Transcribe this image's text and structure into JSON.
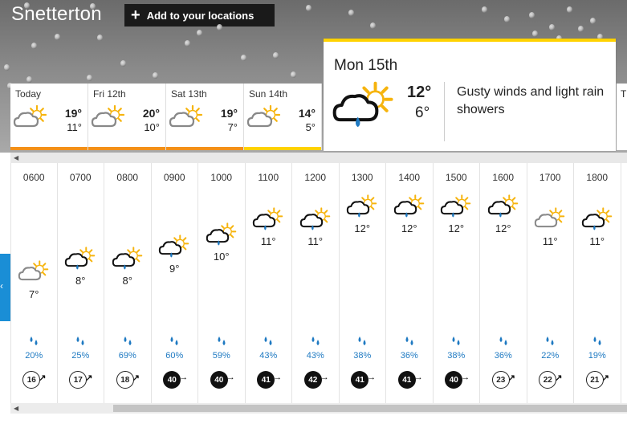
{
  "location": {
    "title": "Snetterton"
  },
  "add_button": {
    "label": "Add to your locations",
    "plus": "+"
  },
  "colors": {
    "today_bar": "#f39018",
    "sun_bar": "#ffd200",
    "accent_blue": "#1a8ed6",
    "rain_blue": "#1f7ac2"
  },
  "days": [
    {
      "label": "Today",
      "hi": "19°",
      "lo": "11°",
      "icon": "sun-cloud-icon",
      "bar": "#f39018"
    },
    {
      "label": "Fri 12th",
      "hi": "20°",
      "lo": "10°",
      "icon": "sun-cloud-icon",
      "bar": "#f39018"
    },
    {
      "label": "Sat 13th",
      "hi": "19°",
      "lo": "7°",
      "icon": "sun-cloud-icon",
      "bar": "#f39018"
    },
    {
      "label": "Sun 14th",
      "hi": "14°",
      "lo": "5°",
      "icon": "sun-cloud-icon",
      "bar": "#ffd200"
    }
  ],
  "selected_day": {
    "day": "Mon",
    "date": "15th",
    "hi": "12°",
    "lo": "6°",
    "description": "Gusty winds and light rain showers",
    "icon": "sun-rain-cloud-icon"
  },
  "next_day_stub": {
    "label": "T"
  },
  "hours": [
    {
      "time": "0600",
      "temp": "7°",
      "icon": "sun-cloud-icon",
      "rain": "20%",
      "wind": "16",
      "wind_style": "light"
    },
    {
      "time": "0700",
      "temp": "8°",
      "icon": "sun-rain-cloud-icon",
      "rain": "25%",
      "wind": "17",
      "wind_style": "light"
    },
    {
      "time": "0800",
      "temp": "8°",
      "icon": "sun-rain-cloud-icon",
      "rain": "69%",
      "wind": "18",
      "wind_style": "light"
    },
    {
      "time": "0900",
      "temp": "9°",
      "icon": "sun-rain-cloud-icon",
      "rain": "60%",
      "wind": "40",
      "wind_style": "dark"
    },
    {
      "time": "1000",
      "temp": "10°",
      "icon": "sun-rain-cloud-icon",
      "rain": "59%",
      "wind": "40",
      "wind_style": "dark"
    },
    {
      "time": "1100",
      "temp": "11°",
      "icon": "sun-rain-cloud-icon",
      "rain": "43%",
      "wind": "41",
      "wind_style": "dark"
    },
    {
      "time": "1200",
      "temp": "11°",
      "icon": "sun-rain-cloud-icon",
      "rain": "43%",
      "wind": "42",
      "wind_style": "dark"
    },
    {
      "time": "1300",
      "temp": "12°",
      "icon": "sun-rain-cloud-icon",
      "rain": "38%",
      "wind": "41",
      "wind_style": "dark"
    },
    {
      "time": "1400",
      "temp": "12°",
      "icon": "sun-rain-cloud-icon",
      "rain": "36%",
      "wind": "41",
      "wind_style": "dark"
    },
    {
      "time": "1500",
      "temp": "12°",
      "icon": "sun-rain-cloud-icon",
      "rain": "38%",
      "wind": "40",
      "wind_style": "dark"
    },
    {
      "time": "1600",
      "temp": "12°",
      "icon": "sun-rain-cloud-icon",
      "rain": "36%",
      "wind": "23",
      "wind_style": "light"
    },
    {
      "time": "1700",
      "temp": "11°",
      "icon": "sun-cloud-icon",
      "rain": "22%",
      "wind": "22",
      "wind_style": "light"
    },
    {
      "time": "1800",
      "temp": "11°",
      "icon": "sun-rain-cloud-icon",
      "rain": "19%",
      "wind": "21",
      "wind_style": "light"
    }
  ],
  "hour_icon_offsets": [
    120,
    103,
    103,
    88,
    73,
    54,
    54,
    38,
    38,
    38,
    38,
    54,
    54
  ]
}
